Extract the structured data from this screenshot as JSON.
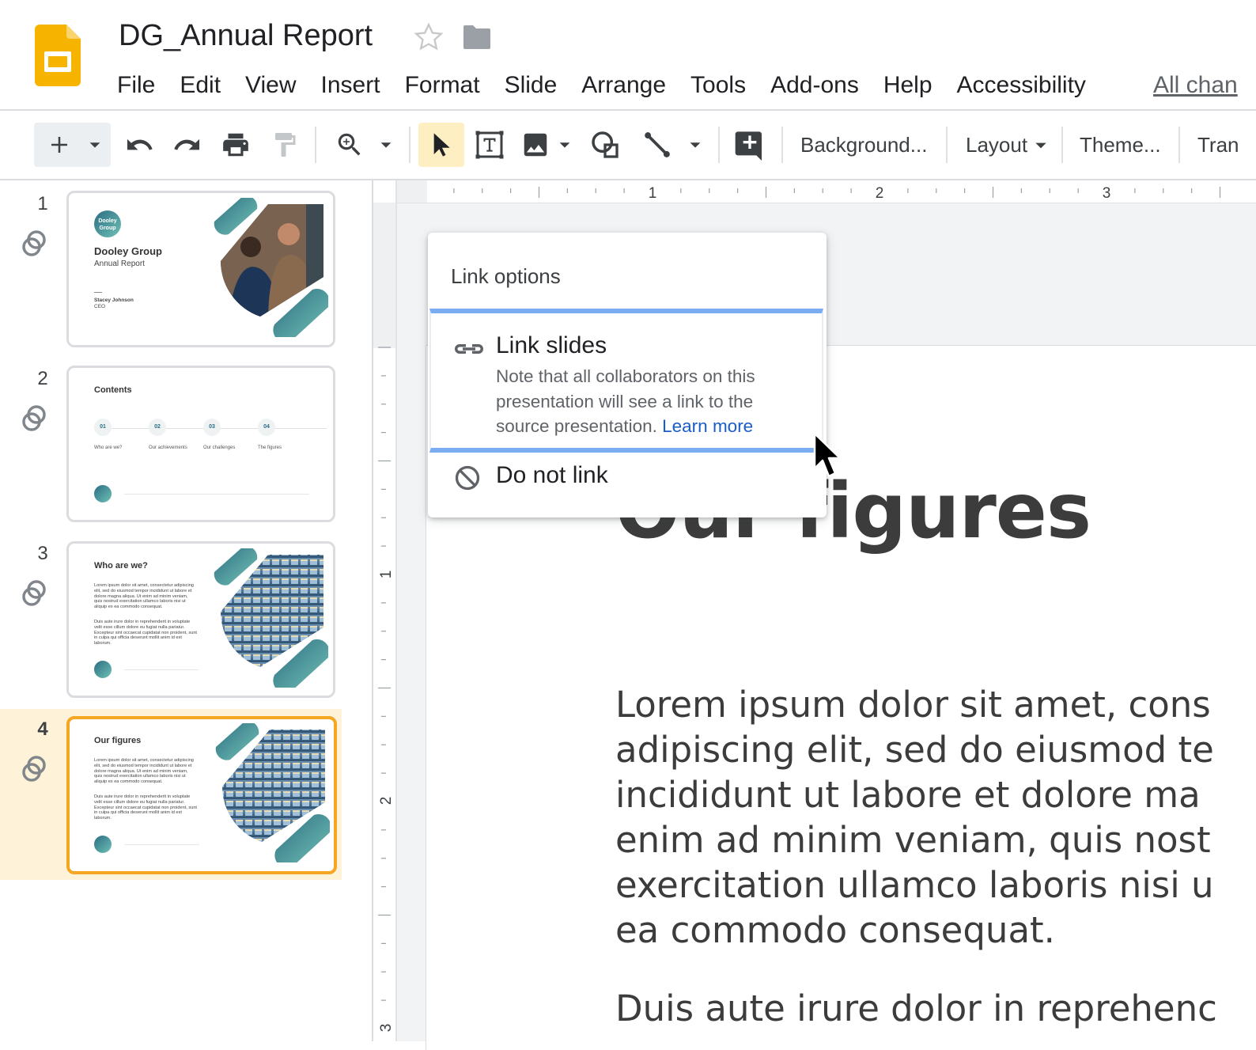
{
  "app": {
    "doc_title": "DG_Annual Report",
    "all_changes_label": "All chan",
    "accent_color": "#f5a623"
  },
  "menubar": {
    "items": [
      "File",
      "Edit",
      "View",
      "Insert",
      "Format",
      "Slide",
      "Arrange",
      "Tools",
      "Add-ons",
      "Help",
      "Accessibility"
    ]
  },
  "toolbar": {
    "icons": [
      "new-slide-icon",
      "dropdown-arrow-icon",
      "undo-icon",
      "redo-icon",
      "print-icon",
      "paint-format-icon",
      "zoom-icon",
      "dropdown-arrow-icon",
      "select-cursor-icon",
      "text-box-icon",
      "image-icon",
      "dropdown-arrow-icon",
      "shape-icon",
      "line-icon",
      "dropdown-arrow-icon",
      "add-comment-icon"
    ],
    "background_label": "Background...",
    "layout_label": "Layout",
    "theme_label": "Theme...",
    "transition_label": "Tran"
  },
  "rulers": {
    "horizontal_marks": [
      "1",
      "2",
      "3"
    ],
    "vertical_marks": [
      "1",
      "2",
      "3"
    ]
  },
  "filmstrip": {
    "selected_index": 4,
    "slides": [
      {
        "number": "1",
        "logo_text": "Dooley Group",
        "title": "Dooley Group",
        "subtitle": "Annual Report",
        "name": "Stacey Johnson",
        "role": "CEO"
      },
      {
        "number": "2",
        "title": "Contents",
        "steps": [
          {
            "num": "01",
            "label": "Who are we?"
          },
          {
            "num": "02",
            "label": "Our achievements"
          },
          {
            "num": "03",
            "label": "Our challenges"
          },
          {
            "num": "04",
            "label": "The figures"
          }
        ]
      },
      {
        "number": "3",
        "title": "Who are we?",
        "body1": "Lorem ipsum dolor sit amet, consectetur adipiscing elit, sed do eiusmod tempor incididunt ut labore et dolore magna aliqua. Ut enim ad minim veniam, quis nostrud exercitation ullamco laboris nisi ut aliquip ex ea commodo consequat.",
        "body2": "Duis aute irure dolor in reprehenderit in voluptate velit esse cillum dolore eu fugiat nulla pariatur. Excepteur sint occaecat cupidatat non proident, sunt in culpa qui officia deserunt mollit anim id est laborum."
      },
      {
        "number": "4",
        "title": "Our figures",
        "body1": "Lorem ipsum dolor sit amet, consectetur adipiscing elit, sed do eiusmod tempor incididunt ut labore et dolore magna aliqua. Ut enim ad minim veniam, quis nostrud exercitation ullamco laboris nisi ut aliquip ex ea commodo consequat.",
        "body2": "Duis aute irure dolor in reprehenderit in voluptate velit esse cillum dolore eu fugiat nulla pariatur. Excepteur sint occaecat cupidatat non proident, sunt in culpa qui officia deserunt mollit anim id est laborum."
      }
    ]
  },
  "slide": {
    "title": "Our figures",
    "body_p1_lines": [
      "Lorem ipsum dolor sit amet, cons",
      "adipiscing elit, sed do eiusmod te",
      "incididunt ut labore et dolore ma",
      "enim ad minim veniam, quis nost",
      "exercitation ullamco laboris nisi u",
      "ea commodo consequat."
    ],
    "body_p2_lines": [
      "Duis aute irure dolor in reprehenc"
    ]
  },
  "link_popup": {
    "heading": "Link options",
    "link_slides_label": "Link slides",
    "link_slides_note": "Note that all collaborators on this presentation will see a link to the source presentation.",
    "learn_more_label": "Learn more",
    "do_not_link_label": "Do not link",
    "highlight_color": "#7aacf2",
    "link_color": "#1a5cc8"
  }
}
